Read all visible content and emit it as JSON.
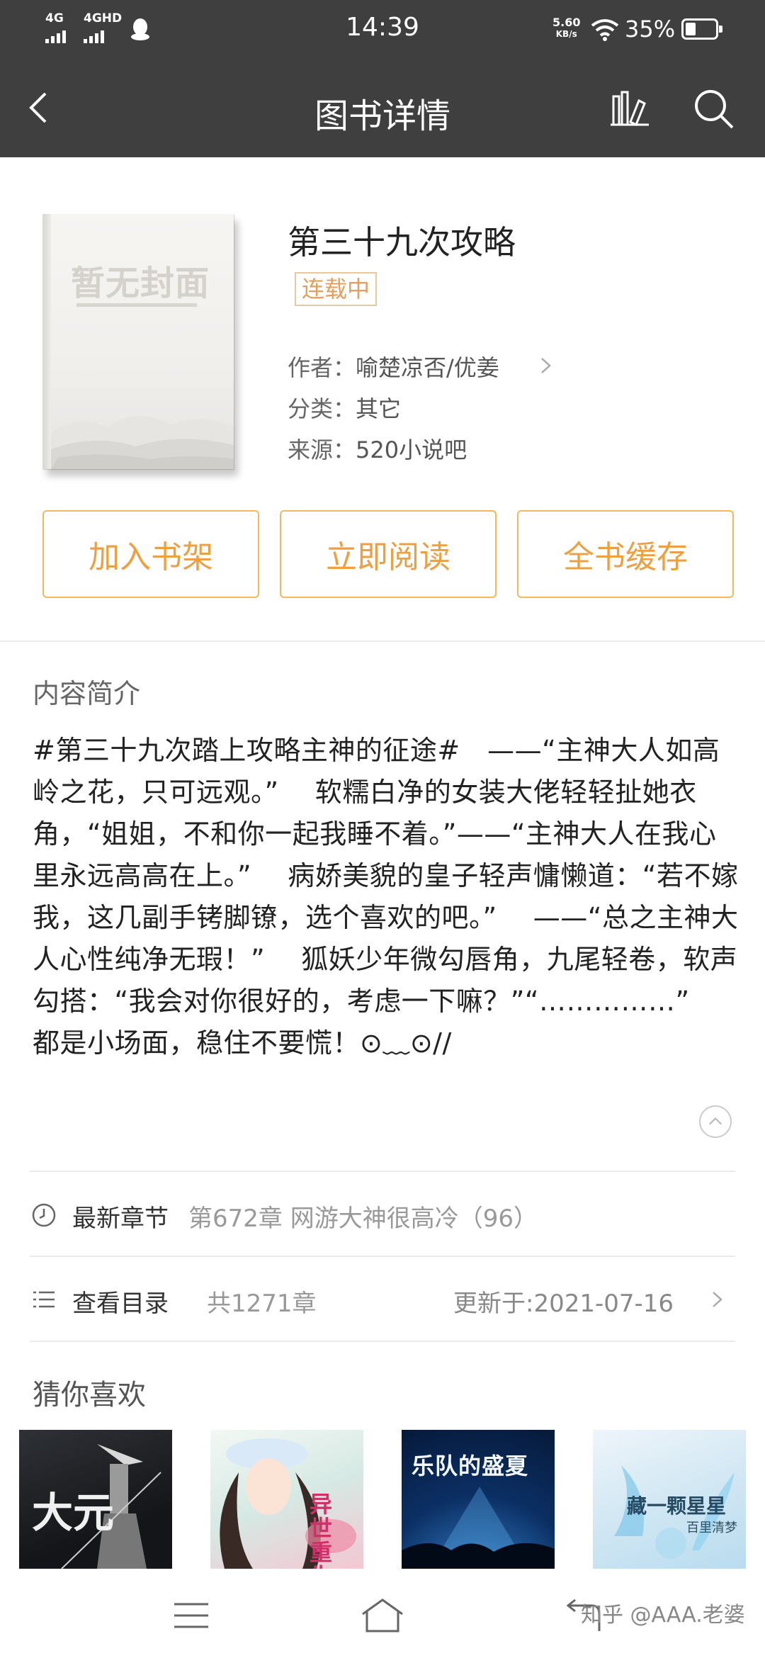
{
  "status_bar": {
    "sim1": "4G",
    "sim2": "4GHD",
    "time": "14:39",
    "speed_value": "5.60",
    "speed_unit": "KB/s",
    "battery": "35%"
  },
  "app_bar": {
    "title": "图书详情"
  },
  "book": {
    "cover_placeholder": "暂无封面",
    "title": "第三十九次攻略",
    "status": "连载中",
    "author_label": "作者：",
    "author": "喻楚凉否/优姜",
    "category_label": "分类：",
    "category": "其它",
    "source_label": "来源：",
    "source": "520小说吧"
  },
  "actions": {
    "add_shelf": "加入书架",
    "read_now": "立即阅读",
    "cache_all": "全书缓存"
  },
  "intro": {
    "heading": "内容简介",
    "text": "#第三十九次踏上攻略主神的征途#　——“主神大人如高岭之花，只可远观。”　 软糯白净的女装大佬轻轻扯她衣角，“姐姐，不和你一起我睡不着。”——“主神大人在我心里永远高高在上。”　 病娇美貌的皇子轻声慵懒道：“若不嫁我，这几副手铐脚镣，选个喜欢的吧。”　 ——“总之主神大人心性纯净无瑕！”　 狐妖少年微勾唇角，九尾轻卷，软声勾搭：“我会对你很好的，考虑一下嘛？”“……………”　 都是小场面，稳住不要慌！⊙﹏⊙//"
  },
  "latest": {
    "label": "最新章节",
    "chapter": "第672章 网游大神很高冷（96）"
  },
  "catalog": {
    "label": "查看目录",
    "count": "共1271章",
    "updated": "更新于:2021-07-16"
  },
  "recommend": {
    "heading": "猜你喜欢",
    "items": [
      {
        "cover_text": "大元",
        "theme": "ink-warrior"
      },
      {
        "cover_text": "异世重生",
        "theme": "anime-girl"
      },
      {
        "cover_text": "乐队的盛夏",
        "theme": "concert-blue"
      },
      {
        "cover_text": "藏一颗星星",
        "sub": "百里清梦",
        "theme": "pale-blue"
      }
    ]
  },
  "watermark": "知乎 @AAA.老婆",
  "colors": {
    "topbar": "#3f3f3f",
    "accent": "#eba044",
    "accent_border": "#f2b860"
  }
}
